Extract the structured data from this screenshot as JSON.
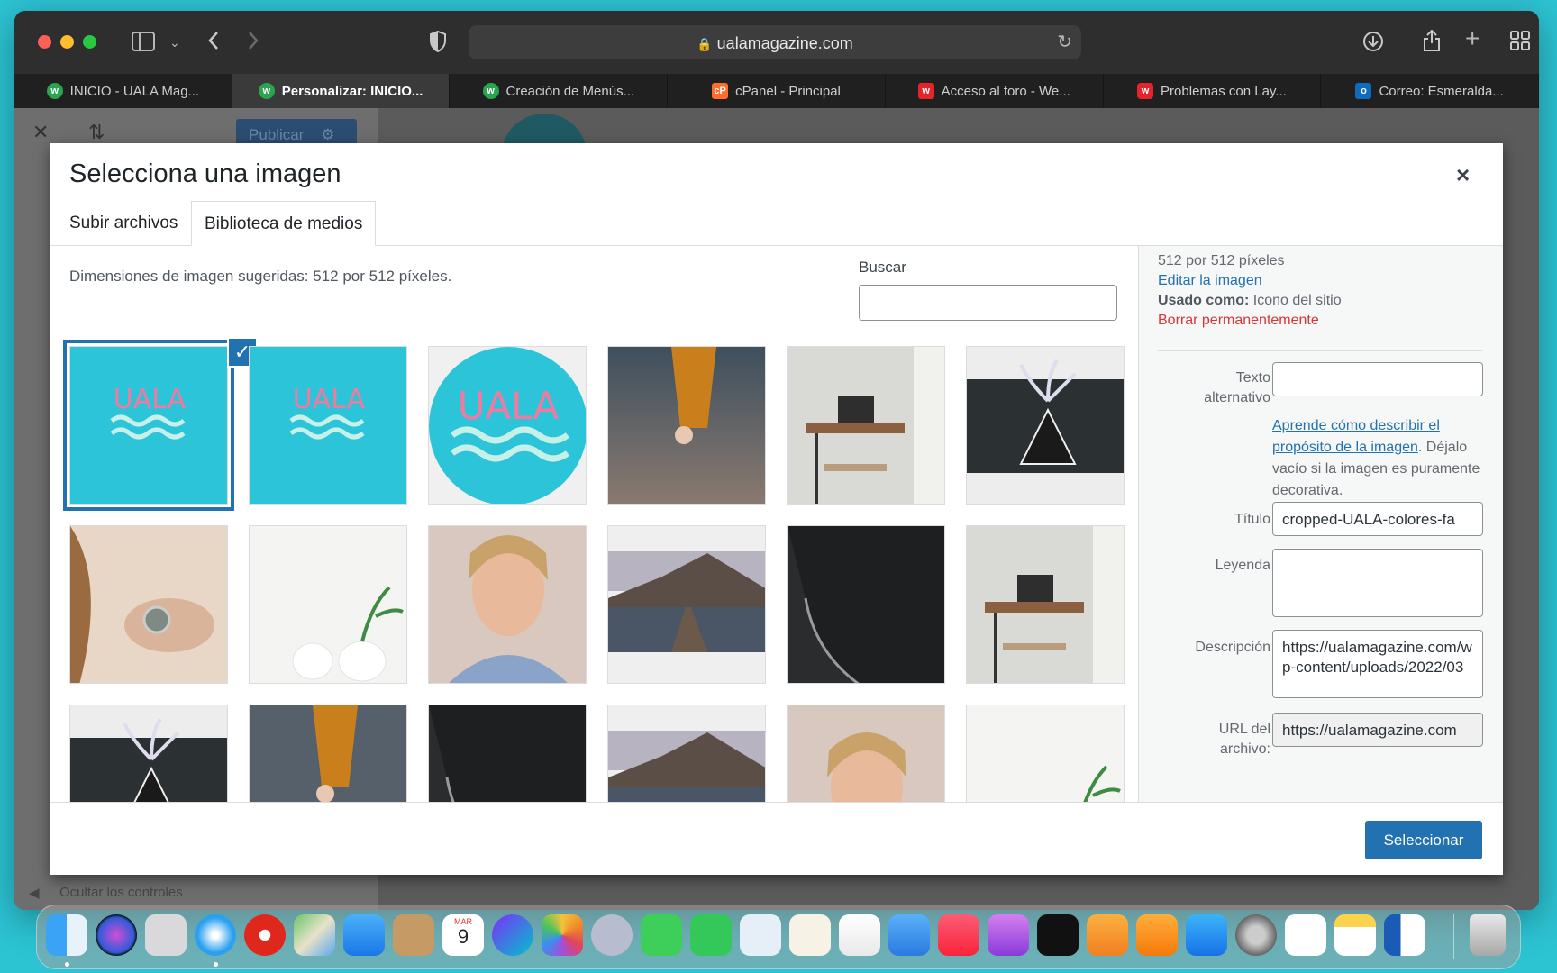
{
  "browser": {
    "url": "ualamagazine.com",
    "tabs": [
      {
        "label": "INICIO - UALA Mag...",
        "favicon": "uala-favicon",
        "active": false
      },
      {
        "label": "Personalizar: INICIO...",
        "favicon": "uala-favicon",
        "active": true
      },
      {
        "label": "Creación de Menús...",
        "favicon": "uala-favicon",
        "active": false
      },
      {
        "label": "cPanel - Principal",
        "favicon": "cpanel-favicon",
        "active": false
      },
      {
        "label": "Acceso al foro - We...",
        "favicon": "webnode-favicon",
        "active": false
      },
      {
        "label": "Problemas con Lay...",
        "favicon": "webnode-favicon",
        "active": false
      },
      {
        "label": "Correo: Esmeralda...",
        "favicon": "outlook-favicon",
        "active": false
      }
    ]
  },
  "background": {
    "publish_label": "Publicar",
    "hide_controls": "Ocultar los controles"
  },
  "modal": {
    "title": "Selecciona una imagen",
    "close": "×",
    "tabs": [
      "Subir archivos",
      "Biblioteca de medios"
    ],
    "active_tab": 1,
    "suggested": "Dimensiones de imagen sugeridas: 512 por 512 píxeles.",
    "search_label": "Buscar",
    "search_value": "",
    "thumbnails": [
      "uala-logo-square-selected",
      "uala-logo-square",
      "uala-logo-circle",
      "orange-sweater-hand",
      "desk-laptop",
      "plant-laptop-dark",
      "hand-ring",
      "vases-plant",
      "woman-portrait",
      "lake-mountain-dock",
      "phone-closeup",
      "desk-laptop",
      "plant-laptop-dark",
      "orange-sweater-hand",
      "phone-closeup",
      "lake-mountain-dock",
      "woman-portrait",
      "vases-plant"
    ],
    "details": {
      "dimensions": "512 por 512 píxeles",
      "edit_link": "Editar la imagen",
      "used_as_label": "Usado como:",
      "used_as_value": "Icono del sitio",
      "delete_link": "Borrar permanentemente",
      "alt_label": "Texto alternativo",
      "alt_value": "",
      "help_link": "Aprende cómo describir el propósito de la imagen",
      "help_text": ". Déjalo vacío si la imagen es puramente decorativa.",
      "title_label": "Título",
      "title_value": "cropped-UALA-colores-fa",
      "caption_label": "Leyenda",
      "caption_value": "",
      "description_label": "Descripción",
      "description_value": "https://ualamagazine.com/wp-content/uploads/2022/03",
      "url_label": "URL del archivo:",
      "url_value": "https://ualamagazine.com"
    },
    "select_button": "Seleccionar"
  },
  "dock": {
    "apps": [
      "finder",
      "siri",
      "launchpad",
      "safari",
      "youtube",
      "maps",
      "mail",
      "contacts",
      "calendar",
      "canva",
      "photos",
      "instruments",
      "messages",
      "facetime",
      "preview",
      "pages-doc",
      "numbers",
      "keynote",
      "music",
      "podcasts",
      "appletv",
      "pages",
      "books",
      "appstore",
      "settings",
      "reminders",
      "notes",
      "word",
      "trash"
    ],
    "calendar_month": "MAR",
    "calendar_day": "9"
  }
}
